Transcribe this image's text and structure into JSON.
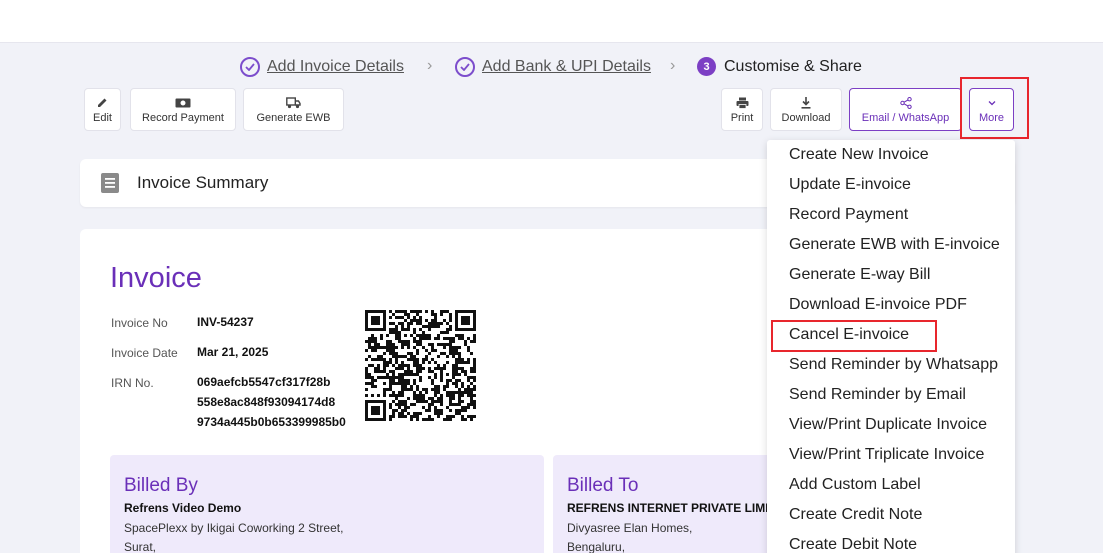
{
  "stepper": {
    "step1": "Add Invoice Details",
    "step2": "Add Bank & UPI Details",
    "step3_num": "3",
    "step3": "Customise & Share"
  },
  "toolbar": {
    "edit": "Edit",
    "record_payment": "Record Payment",
    "generate_ewb": "Generate EWB",
    "print": "Print",
    "download": "Download",
    "email_whatsapp": "Email / WhatsApp",
    "more": "More"
  },
  "summary": {
    "title": "Invoice Summary"
  },
  "invoice": {
    "heading": "Invoice",
    "no_label": "Invoice No",
    "no_value": "INV-54237",
    "date_label": "Invoice Date",
    "date_value": "Mar 21, 2025",
    "irn_label": "IRN No.",
    "irn_line1": "069aefcb5547cf317f28b",
    "irn_line2": "558e8ac848f93094174d8",
    "irn_line3": "9734a445b0b653399985b0"
  },
  "billed_by": {
    "heading": "Billed By",
    "name": "Refrens Video Demo",
    "addr1": "SpacePlexx by Ikigai Coworking 2 Street,",
    "addr2": "Surat,"
  },
  "billed_to": {
    "heading": "Billed To",
    "name": "REFRENS INTERNET PRIVATE LIMITED",
    "addr1": "Divyasree Elan Homes,",
    "addr2": "Bengaluru,"
  },
  "more_menu": [
    "Create New Invoice",
    "Update E-invoice",
    "Record Payment",
    "Generate EWB with E-invoice",
    "Generate E-way Bill",
    "Download E-invoice PDF",
    "Cancel E-invoice",
    "Send Reminder by Whatsapp",
    "Send Reminder by Email",
    "View/Print Duplicate Invoice",
    "View/Print Triplicate Invoice",
    "Add Custom Label",
    "Create Credit Note",
    "Create Debit Note"
  ],
  "colors": {
    "accent": "#6a2fb8",
    "highlight": "#e8262d",
    "billbox": "#efeafb"
  }
}
